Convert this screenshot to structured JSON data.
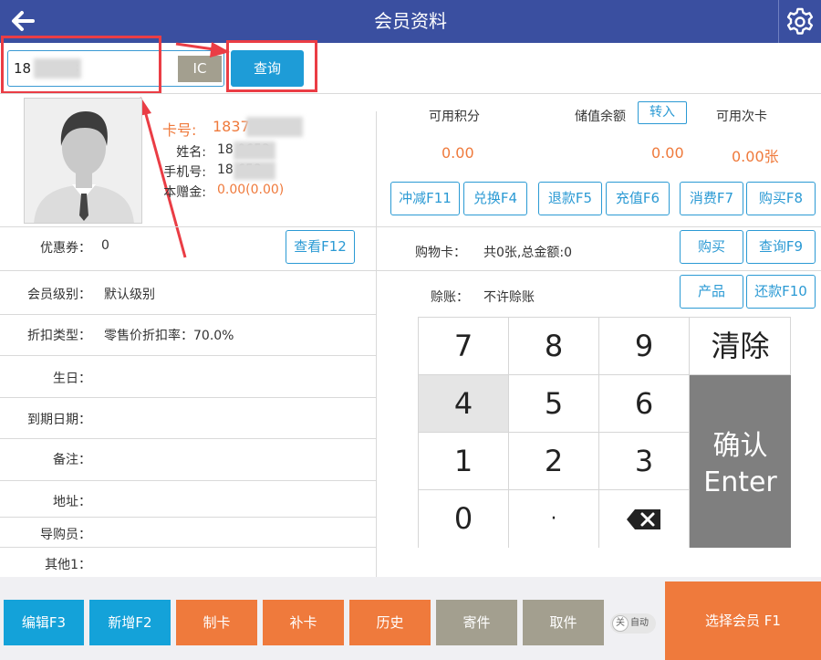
{
  "header": {
    "title": "会员资料",
    "back_icon": "arrow-left-icon",
    "settings_icon": "gear-icon"
  },
  "search": {
    "value": "18   0653",
    "ic_label": "IC",
    "query_label": "查询"
  },
  "profile": {
    "card_label": "卡号:",
    "card_value": "1837        653",
    "name_label": "姓名:",
    "name_value": "18          0653",
    "phone_label": "手机号:",
    "phone_value": "18          653",
    "balance_label": "本赠金:",
    "balance_value": "0.00(0.00)"
  },
  "left_fields": {
    "coupon_label": "优惠券：",
    "coupon_value": "0",
    "view_button": "查看F12",
    "level_label": "会员级别：",
    "level_value": "默认级别",
    "discount_label": "折扣类型：",
    "discount_value": "零售价折扣率：70.0%",
    "birthday_label": "生日：",
    "expiry_label": "到期日期：",
    "note_label": "备注：",
    "address_label": "地址：",
    "guide_label": "导购员：",
    "other_label": "其他1："
  },
  "stats": {
    "points_label": "可用积分",
    "points_value": "0.00",
    "stored_label": "储值余额",
    "transfer_label": "转入",
    "stored_value": "0.00",
    "times_label": "可用次卡",
    "times_value": "0.00张"
  },
  "action_buttons": [
    "冲减F11",
    "兑换F4",
    "退款F5",
    "充值F6",
    "消费F7",
    "购买F8"
  ],
  "shopping": {
    "label": "购物卡：",
    "value": "共0张,总金额:0",
    "buy": "购买",
    "query": "查询F9"
  },
  "credit": {
    "label": "赊账：",
    "value": "不许赊账",
    "product": "产品",
    "repay": "还款F10"
  },
  "keypad": {
    "keys": [
      "7",
      "8",
      "9",
      "4",
      "5",
      "6",
      "1",
      "2",
      "3",
      "0",
      "·"
    ],
    "clear": "清除",
    "enter_line1": "确认",
    "enter_line2": "Enter",
    "backspace_icon": "backspace-icon"
  },
  "bottom": {
    "edit": "编辑F3",
    "add": "新增F2",
    "make_card": "制卡",
    "reissue": "补卡",
    "history": "历史",
    "deposit": "寄件",
    "pickup": "取件",
    "toggle_off": "关",
    "toggle_auto": "自动",
    "select_member": "选择会员 F1"
  },
  "colors": {
    "header": "#3a4fa0",
    "accent": "#1e9cd7",
    "orange": "#ef7a3c",
    "annotation": "#ea3d45"
  }
}
